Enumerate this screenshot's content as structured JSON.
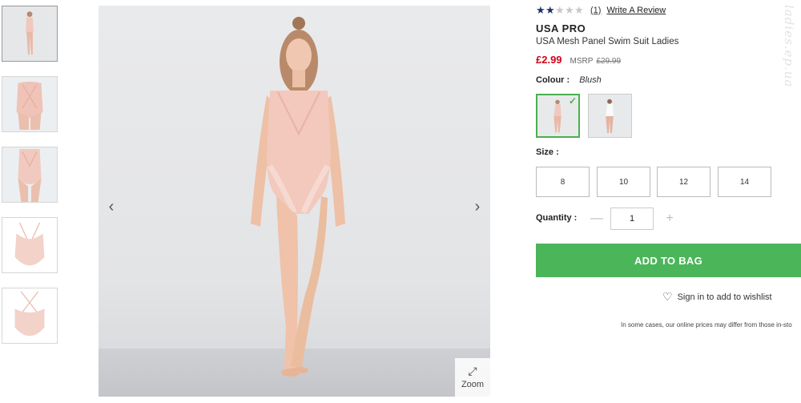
{
  "gallery": {
    "prev_icon": "‹",
    "next_icon": "›",
    "zoom_label": "Zoom",
    "zoom_icon": "⤢"
  },
  "product": {
    "rating_count": "(1)",
    "write_review": "Write A Review",
    "brand": "USA PRO",
    "name": "USA Mesh Panel Swim Suit Ladies",
    "price": "£2.99",
    "msrp_label": "MSRP",
    "msrp_value": "£29.99",
    "rating_value": 2,
    "rating_max": 5
  },
  "colour": {
    "label": "Colour :",
    "value": "Blush"
  },
  "size": {
    "label": "Size :",
    "options": [
      "8",
      "10",
      "12",
      "14"
    ]
  },
  "quantity": {
    "label": "Quantity :",
    "value": "1",
    "minus": "—",
    "plus": "+"
  },
  "actions": {
    "add_to_bag": "ADD TO BAG",
    "wishlist": "Sign in to add to wishlist",
    "disclaimer": "In some cases, our online prices may differ from those in-sto"
  },
  "watermark": "ladies.ep.ua",
  "colors": {
    "accent_green": "#4bb55a",
    "price_red": "#d0021b",
    "star_on": "#1a3561"
  }
}
